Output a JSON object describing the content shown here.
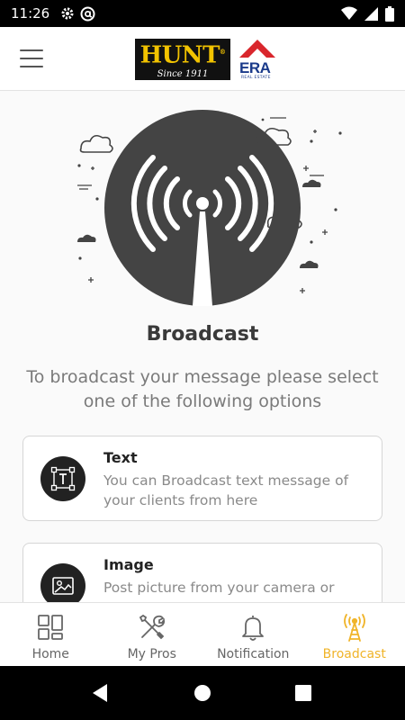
{
  "status_bar": {
    "time": "11:26",
    "left_icons": [
      "gear-icon",
      "at-icon"
    ],
    "right_icons": [
      "wifi-icon",
      "signal-icon",
      "battery-icon"
    ]
  },
  "app_bar": {
    "menu_icon": "hamburger-menu-icon",
    "logo_brand": "HUNT",
    "logo_registered": "®",
    "logo_since": "Since 1911",
    "era_text": "ERA",
    "era_subtext": "REAL ESTATE"
  },
  "main": {
    "title": "Broadcast",
    "subtitle": "To broadcast your message please select one of the following options",
    "options": [
      {
        "icon": "text-box-icon",
        "title": "Text",
        "description": "You can Broadcast text message of your clients from here"
      },
      {
        "icon": "image-icon",
        "title": "Image",
        "description": "Post picture from your camera or"
      }
    ]
  },
  "bottom_nav": {
    "items": [
      {
        "label": "Home",
        "icon": "grid-home-icon",
        "active": false
      },
      {
        "label": "My Pros",
        "icon": "tools-icon",
        "active": false
      },
      {
        "label": "Notification",
        "icon": "bell-icon",
        "active": false
      },
      {
        "label": "Broadcast",
        "icon": "broadcast-tower-icon",
        "active": true
      }
    ]
  },
  "colors": {
    "accent": "#f0b429",
    "hunt_yellow": "#f2c300",
    "era_red": "#d9262c",
    "era_blue": "#1a3a8a",
    "illustration_gray": "#444444"
  },
  "system_nav": [
    "back-icon",
    "home-icon",
    "recents-icon"
  ]
}
